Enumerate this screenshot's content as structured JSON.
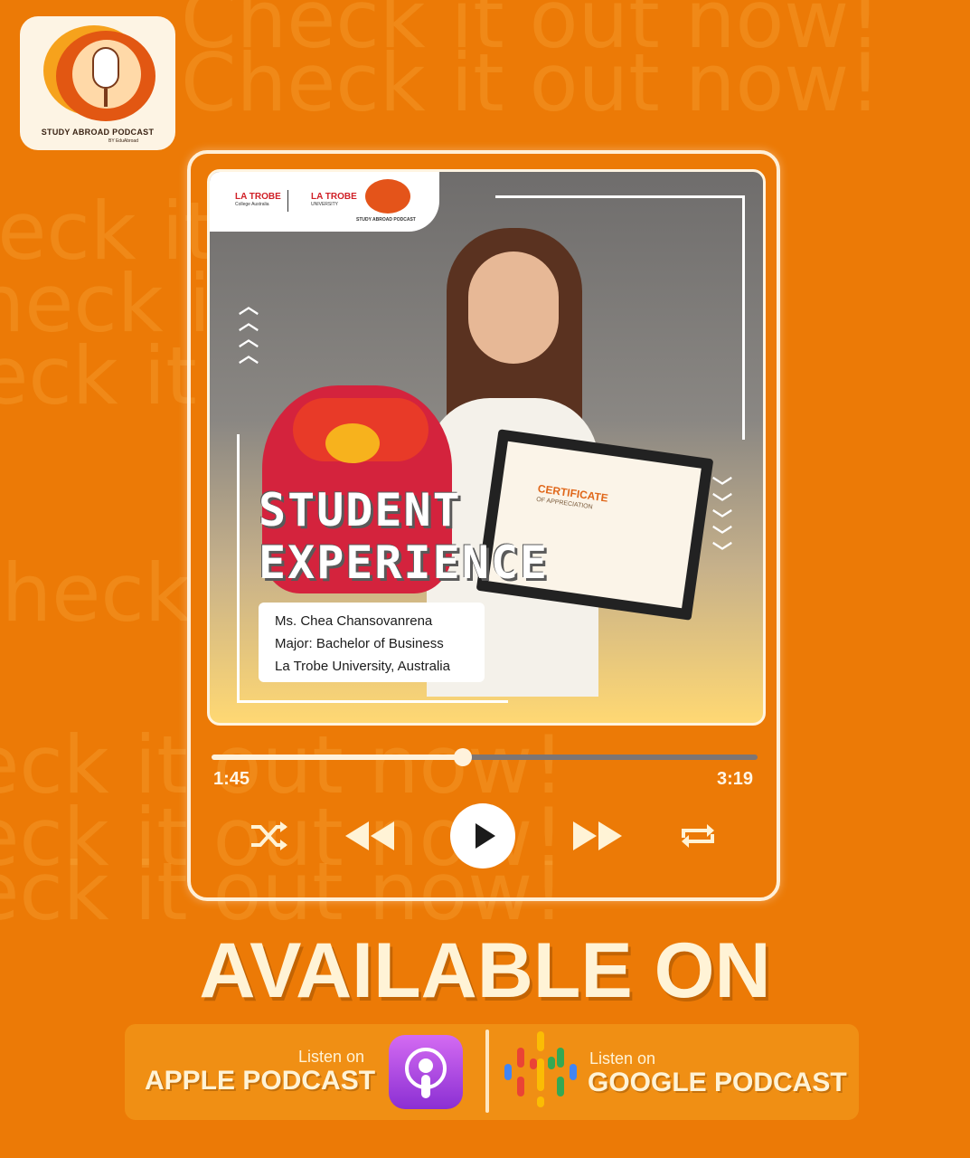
{
  "background": {
    "repeat_text": "Check it out now!"
  },
  "logo": {
    "title": "STUDY ABROAD PODCAST",
    "by": "BY EduAbroad"
  },
  "cover": {
    "partner_1": "LA TROBE",
    "partner_1_sub": "College Australia",
    "partner_2": "LA TROBE",
    "partner_2_sub": "UNIVERSITY",
    "mini_logo_text": "STUDY ABROAD PODCAST",
    "certificate_title": "CERTIFICATE",
    "certificate_subtitle": "OF APPRECIATION",
    "title_line_1": "STUDENT",
    "title_line_2": "EXPERIENCE",
    "student_name": "Ms. Chea Chansovanrena",
    "major": "Major: Bachelor of Business",
    "university": "La Trobe University, Australia"
  },
  "player": {
    "current_time": "1:45",
    "total_time": "3:19",
    "progress": 0.46,
    "controls": [
      "shuffle-icon",
      "rewind-icon",
      "play-icon",
      "fast-forward-icon",
      "repeat-icon"
    ]
  },
  "cta": {
    "headline": "AVAILABLE ON",
    "apple": {
      "listen": "Listen on",
      "name": "APPLE PODCAST"
    },
    "google": {
      "listen": "Listen on",
      "name": "GOOGLE PODCAST"
    }
  },
  "colors": {
    "background": "#ec7a06",
    "accent_cream": "#fff3d6",
    "apple_purple": "#a84ee0"
  }
}
